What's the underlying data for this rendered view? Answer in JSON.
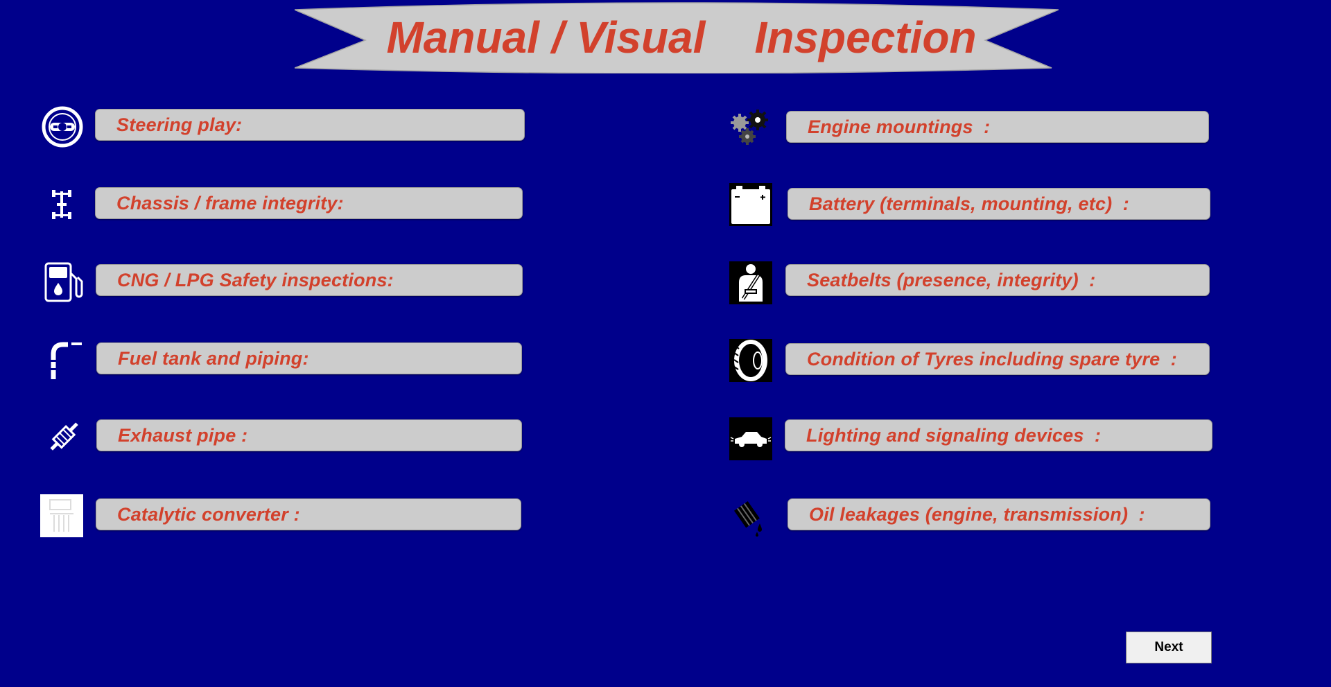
{
  "title": "Manual / Visual    Inspection",
  "left_items": [
    {
      "label": "Steering play:",
      "icon": "steering-wheel-icon"
    },
    {
      "label": "Chassis / frame integrity:",
      "icon": "chassis-icon"
    },
    {
      "label": "CNG / LPG Safety inspections:",
      "icon": "fuel-pump-icon"
    },
    {
      "label": "Fuel tank and piping:",
      "icon": "pipe-icon"
    },
    {
      "label": "Exhaust pipe :",
      "icon": "exhaust-icon"
    },
    {
      "label": "Catalytic converter :",
      "icon": "catalytic-converter-icon"
    }
  ],
  "right_items": [
    {
      "label": "Engine mountings  :",
      "icon": "gears-icon"
    },
    {
      "label": "Battery (terminals, mounting, etc)  :",
      "icon": "battery-icon"
    },
    {
      "label": "Seatbelts (presence, integrity)  :",
      "icon": "seatbelt-icon"
    },
    {
      "label": "Condition of Tyres including spare tyre  :",
      "icon": "tyre-icon"
    },
    {
      "label": "Lighting and signaling devices  :",
      "icon": "car-lights-icon"
    },
    {
      "label": "Oil leakages (engine, transmission)  :",
      "icon": "oil-leak-icon"
    }
  ],
  "next_button": {
    "label": "Next"
  },
  "colors": {
    "background": "#00008b",
    "label_text": "#d2412c",
    "field_fill": "#cccccc"
  }
}
